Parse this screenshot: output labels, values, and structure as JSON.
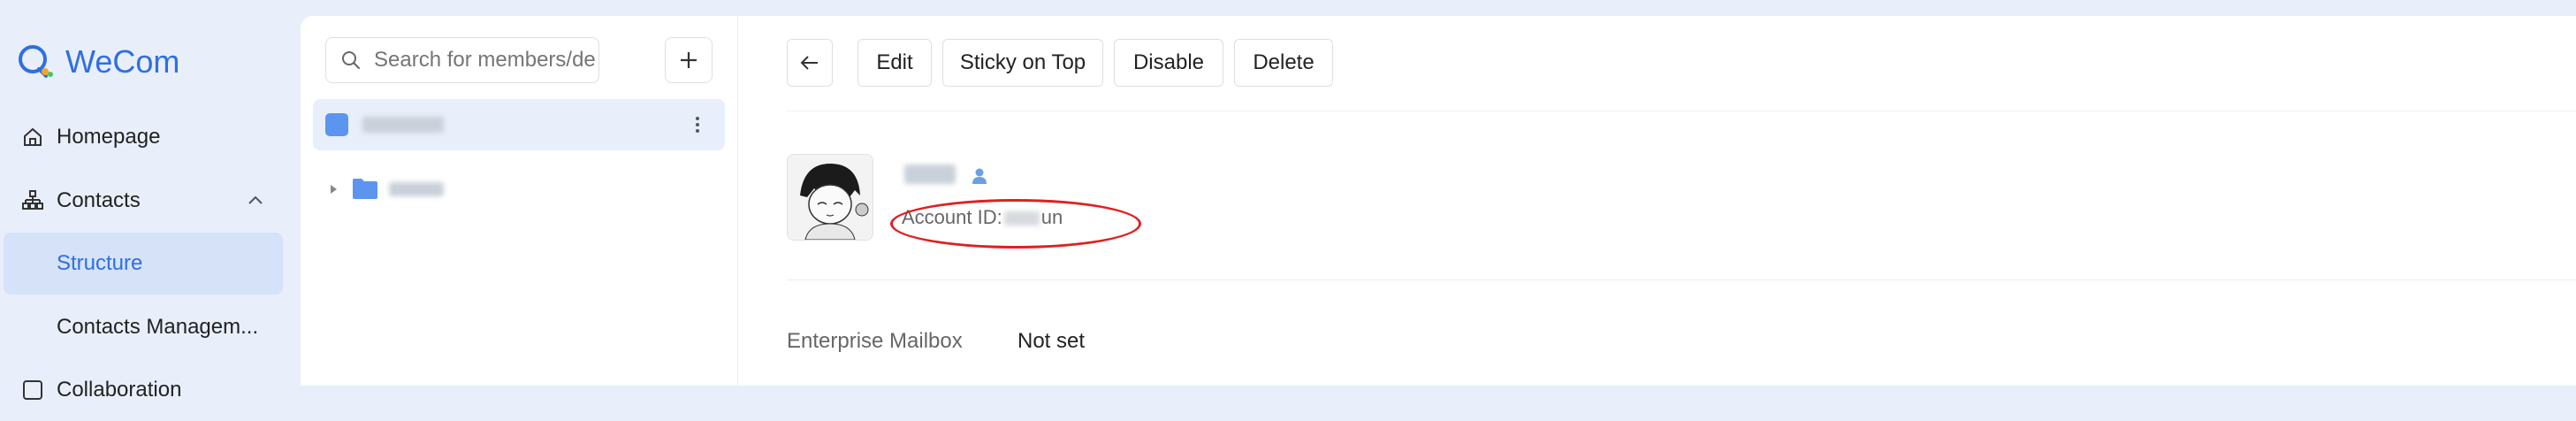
{
  "app": {
    "name": "WeCom",
    "brand_color": "#2f6fe0"
  },
  "sidebar": {
    "items": [
      {
        "label": "Homepage",
        "icon": "home-icon"
      },
      {
        "label": "Contacts",
        "icon": "contacts-icon",
        "expanded": true
      },
      {
        "label": "Structure",
        "active": true
      },
      {
        "label": "Contacts Managem..."
      },
      {
        "label": "Collaboration",
        "icon": "collaboration-icon"
      }
    ]
  },
  "tree": {
    "search_placeholder": "Search for members/dep",
    "add_icon": "plus-icon",
    "more_icon": "more-vertical-icon",
    "folder_icon": "folder-icon"
  },
  "detail": {
    "toolbar": {
      "back_icon": "arrow-left-icon",
      "edit": "Edit",
      "sticky": "Sticky on Top",
      "disable": "Disable",
      "delete": "Delete"
    },
    "account_label": "Account ID:",
    "account_suffix": "un",
    "fields": [
      {
        "label": "Enterprise Mailbox",
        "value": "Not set"
      }
    ]
  }
}
